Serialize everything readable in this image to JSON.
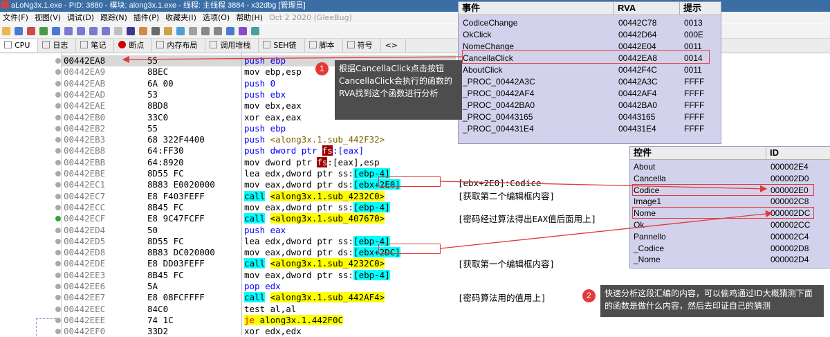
{
  "window": {
    "title": "aLoNg3x.1.exe - PID: 3880 - 模块: along3x.1.exe - 线程: 主线程 3884 - x32dbg [管理员]"
  },
  "menu": {
    "items": [
      "文件(F)",
      "视图(V)",
      "调试(D)",
      "跟踪(N)",
      "插件(P)",
      "收藏夹(I)",
      "选项(O)",
      "帮助(H)"
    ],
    "date": "Oct 2 2020 (GleeBug)"
  },
  "tabs": [
    "CPU",
    "日志",
    "笔记",
    "断点",
    "内存布局",
    "调用堆栈",
    "SEH链",
    "脚本",
    "符号",
    "<>"
  ],
  "disasm": [
    {
      "addr": "00442EA8",
      "bytes": "55",
      "ins": [
        [
          "push",
          "k-push"
        ],
        [
          " ebp",
          "k-push"
        ]
      ]
    },
    {
      "addr": "00442EA9",
      "bytes": "8BEC",
      "ins": [
        [
          "mov ebp,esp",
          ""
        ]
      ]
    },
    {
      "addr": "00442EAB",
      "bytes": "6A 00",
      "ins": [
        [
          "push 0",
          "k-push"
        ]
      ]
    },
    {
      "addr": "00442EAD",
      "bytes": "53",
      "ins": [
        [
          "push ebx",
          "k-push"
        ]
      ]
    },
    {
      "addr": "00442EAE",
      "bytes": "8BD8",
      "ins": [
        [
          "mov ebx,eax",
          ""
        ]
      ]
    },
    {
      "addr": "00442EB0",
      "bytes": "33C0",
      "ins": [
        [
          "xor eax,eax",
          ""
        ]
      ]
    },
    {
      "addr": "00442EB2",
      "bytes": "55",
      "ins": [
        [
          "push ebp",
          "k-push"
        ]
      ]
    },
    {
      "addr": "00442EB3",
      "bytes": "68 322F4400",
      "ins": [
        [
          "push ",
          "k-push"
        ],
        [
          "<along3x.1.sub_442F32>",
          "olive"
        ]
      ]
    },
    {
      "addr": "00442EB8",
      "bytes": "64:FF30",
      "ins": [
        [
          "push dword ptr ",
          "k-push"
        ],
        [
          "fs",
          "k-seg"
        ],
        [
          ":[eax]",
          "k-push"
        ]
      ]
    },
    {
      "addr": "00442EBB",
      "bytes": "64:8920",
      "ins": [
        [
          "mov dword ptr ",
          ""
        ],
        [
          "fs",
          "k-seg"
        ],
        [
          ":[eax],esp",
          ""
        ]
      ]
    },
    {
      "addr": "00442EBE",
      "bytes": "8D55 FC",
      "ins": [
        [
          "lea edx,dword ptr ss:",
          ""
        ],
        [
          "[ebp-4]",
          "k-ref"
        ]
      ]
    },
    {
      "addr": "00442EC1",
      "bytes": "8B83 E0020000",
      "ins": [
        [
          "mov eax,dword ptr ds:",
          ""
        ],
        [
          "[ebx+2E0]",
          "k-ref"
        ]
      ]
    },
    {
      "addr": "00442EC7",
      "bytes": "E8 F403FEFF",
      "ins": [
        [
          "call",
          "k-call"
        ],
        [
          " ",
          ""
        ],
        [
          "<along3x.1.sub_4232C0>",
          "k-tgt"
        ]
      ]
    },
    {
      "addr": "00442ECC",
      "bytes": "8B45 FC",
      "ins": [
        [
          "mov eax,dword ptr ss:",
          ""
        ],
        [
          "[ebp-4]",
          "k-ref"
        ]
      ]
    },
    {
      "addr": "00442ECF",
      "bytes": "E8 9C47FCFF",
      "ins": [
        [
          "call",
          "k-call"
        ],
        [
          " ",
          ""
        ],
        [
          "<along3x.1.sub_407670>",
          "k-tgt"
        ]
      ]
    },
    {
      "addr": "00442ED4",
      "bytes": "50",
      "ins": [
        [
          "push eax",
          "k-push"
        ]
      ]
    },
    {
      "addr": "00442ED5",
      "bytes": "8D55 FC",
      "ins": [
        [
          "lea edx,dword ptr ss:",
          ""
        ],
        [
          "[ebp-4]",
          "k-ref"
        ]
      ]
    },
    {
      "addr": "00442ED8",
      "bytes": "8B83 DC020000",
      "ins": [
        [
          "mov eax,dword ptr ds:",
          ""
        ],
        [
          "[ebx+2DC]",
          "k-ref"
        ]
      ]
    },
    {
      "addr": "00442EDE",
      "bytes": "E8 DD03FEFF",
      "ins": [
        [
          "call",
          "k-call"
        ],
        [
          " ",
          ""
        ],
        [
          "<along3x.1.sub_4232C0>",
          "k-tgt"
        ]
      ]
    },
    {
      "addr": "00442EE3",
      "bytes": "8B45 FC",
      "ins": [
        [
          "mov eax,dword ptr ss:",
          ""
        ],
        [
          "[ebp-4]",
          "k-ref"
        ]
      ]
    },
    {
      "addr": "00442EE6",
      "bytes": "5A",
      "ins": [
        [
          "pop edx",
          "k-push"
        ]
      ]
    },
    {
      "addr": "00442EE7",
      "bytes": "E8 08FCFFFF",
      "ins": [
        [
          "call",
          "k-call"
        ],
        [
          " ",
          ""
        ],
        [
          "<along3x.1.sub_442AF4>",
          "k-tgt"
        ]
      ]
    },
    {
      "addr": "00442EEC",
      "bytes": "84C0",
      "ins": [
        [
          "test al,al",
          ""
        ]
      ]
    },
    {
      "addr": "00442EEE",
      "bytes": "74 1C",
      "ins": [
        [
          "je",
          "k-je"
        ],
        [
          " along3x.1.442F0C",
          "k-tgt"
        ]
      ]
    },
    {
      "addr": "00442EF0",
      "bytes": "33D2",
      "ins": [
        [
          "xor edx,edx",
          ""
        ]
      ]
    }
  ],
  "comments": {
    "c1": "[ebx+2E0]:Codice",
    "c2": "[获取第二个编辑框内容]",
    "c3": "[密码经过算法得出EAX值后面用上]",
    "c4": "[获取第一个编辑框内容]",
    "c5": "[密码算法用的值用上]"
  },
  "events_panel": {
    "headers": [
      "事件",
      "RVA",
      "提示"
    ],
    "rows": [
      [
        "CodiceChange",
        "00442C78",
        "0013"
      ],
      [
        "OkClick",
        "00442D64",
        "000E"
      ],
      [
        "NomeChange",
        "00442E04",
        "0011"
      ],
      [
        "CancellaClick",
        "00442EA8",
        "0014"
      ],
      [
        "AboutClick",
        "00442F4C",
        "0011"
      ],
      [
        "_PROC_00442A3C",
        "00442A3C",
        "FFFF"
      ],
      [
        "_PROC_00442AF4",
        "00442AF4",
        "FFFF"
      ],
      [
        "_PROC_00442BA0",
        "00442BA0",
        "FFFF"
      ],
      [
        "_PROC_00443165",
        "00443165",
        "FFFF"
      ],
      [
        "_PROC_004431E4",
        "004431E4",
        "FFFF"
      ]
    ]
  },
  "controls_panel": {
    "headers": [
      "控件",
      "ID"
    ],
    "rows": [
      [
        "About",
        "000002E4"
      ],
      [
        "Cancella",
        "000002D0"
      ],
      [
        "Codice",
        "000002E0"
      ],
      [
        "Image1",
        "000002C8"
      ],
      [
        "Nome",
        "000002DC"
      ],
      [
        "Ok",
        "000002CC"
      ],
      [
        "Pannello",
        "000002C4"
      ],
      [
        "_Codice",
        "000002D8"
      ],
      [
        "_Nome",
        "000002D4"
      ]
    ]
  },
  "callouts": {
    "n1": "1",
    "t1": "根据CancellaClick点击按钮CancellaClick会执行的函数的RVA找到这个函数进行分析",
    "n2": "2",
    "t2": "快速分析这段汇编的内容，可以偷鸡通过ID大概猜测下面的函数是做什么内容，然后去印证自己的猜测"
  },
  "colors": {
    "annotation_red": "#e23a3a",
    "panel_bg": "#d2d2ec",
    "call_cyan": "#00ffff",
    "target_yellow": "#ffff00"
  }
}
